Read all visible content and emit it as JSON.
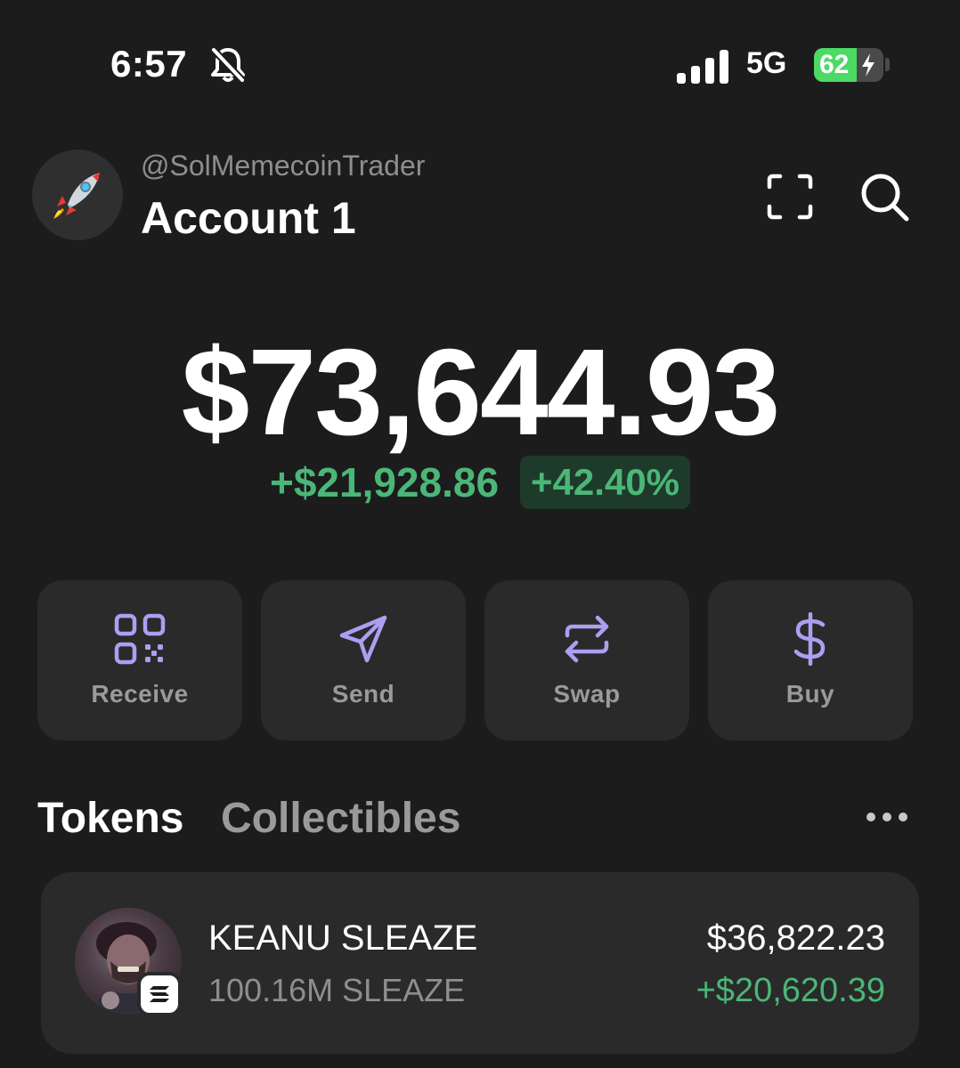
{
  "status_bar": {
    "time": "6:57",
    "network": "5G",
    "battery": "62",
    "battery_level_percent": 62,
    "icons": [
      "bell-slash-icon",
      "signal-bars-icon",
      "battery-icon",
      "charging-bolt-icon"
    ]
  },
  "header": {
    "handle": "@SolMemecoinTrader",
    "account_name": "Account 1",
    "avatar_icon": "rocket-icon",
    "scan_icon": "scan-frame-icon",
    "search_icon": "search-icon"
  },
  "balance": {
    "total": "$73,644.93",
    "change_amount": "+$21,928.86",
    "change_percent": "+42.40%"
  },
  "actions": [
    {
      "label": "Receive",
      "icon": "qr-code-icon"
    },
    {
      "label": "Send",
      "icon": "paper-plane-icon"
    },
    {
      "label": "Swap",
      "icon": "swap-arrows-icon"
    },
    {
      "label": "Buy",
      "icon": "dollar-icon"
    }
  ],
  "tabs": {
    "tokens": "Tokens",
    "collectibles": "Collectibles",
    "more_icon": "more-dots-icon"
  },
  "tokens": [
    {
      "name": "KEANU SLEAZE",
      "amount": "100.16M SLEAZE",
      "value": "$36,822.23",
      "change": "+$20,620.39",
      "chain_icon": "solana-icon"
    }
  ],
  "colors": {
    "background": "#1c1c1c",
    "card": "#2a2a2a",
    "accent": "#ab9ff2",
    "positive": "#4bb677",
    "muted": "#8e8e8e"
  }
}
